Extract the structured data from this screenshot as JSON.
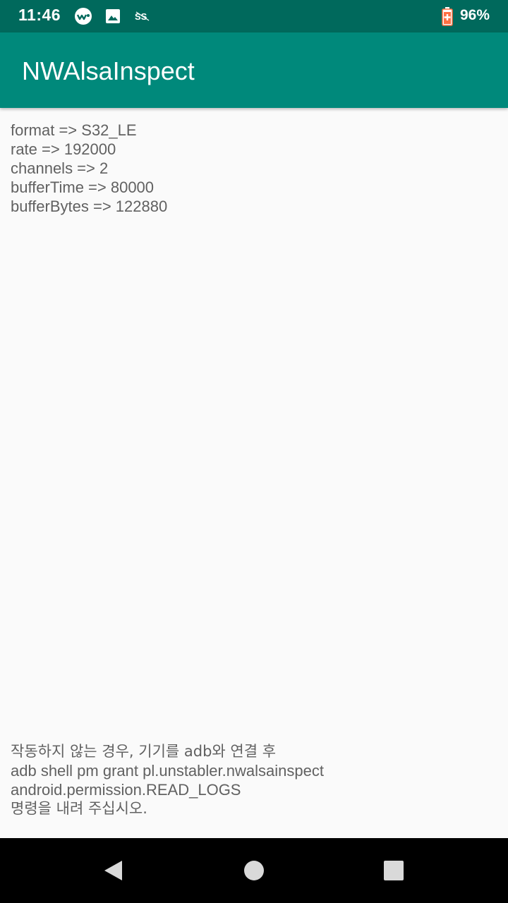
{
  "status_bar": {
    "time": "11:46",
    "battery_percent": "96%",
    "icons": [
      "weather-icon",
      "image-icon",
      "sync-icon",
      "battery-icon"
    ]
  },
  "app_bar": {
    "title": "NWAlsaInspect"
  },
  "info": {
    "lines": [
      "format => S32_LE",
      "rate => 192000",
      "channels => 2",
      "bufferTime => 80000",
      "bufferBytes => 122880"
    ]
  },
  "notice": {
    "lines": [
      "작동하지 않는 경우, 기기를 adb와 연결 후",
      "adb shell pm grant pl.unstabler.nwalsainspect",
      "android.permission.READ_LOGS",
      "명령을 내려 주십시오."
    ]
  },
  "nav_bar": {
    "buttons": [
      "back-icon",
      "home-icon",
      "recents-icon"
    ]
  },
  "colors": {
    "status_bar": "#00695c",
    "app_bar": "#00897b",
    "background": "#fafafa",
    "text": "#616161"
  }
}
